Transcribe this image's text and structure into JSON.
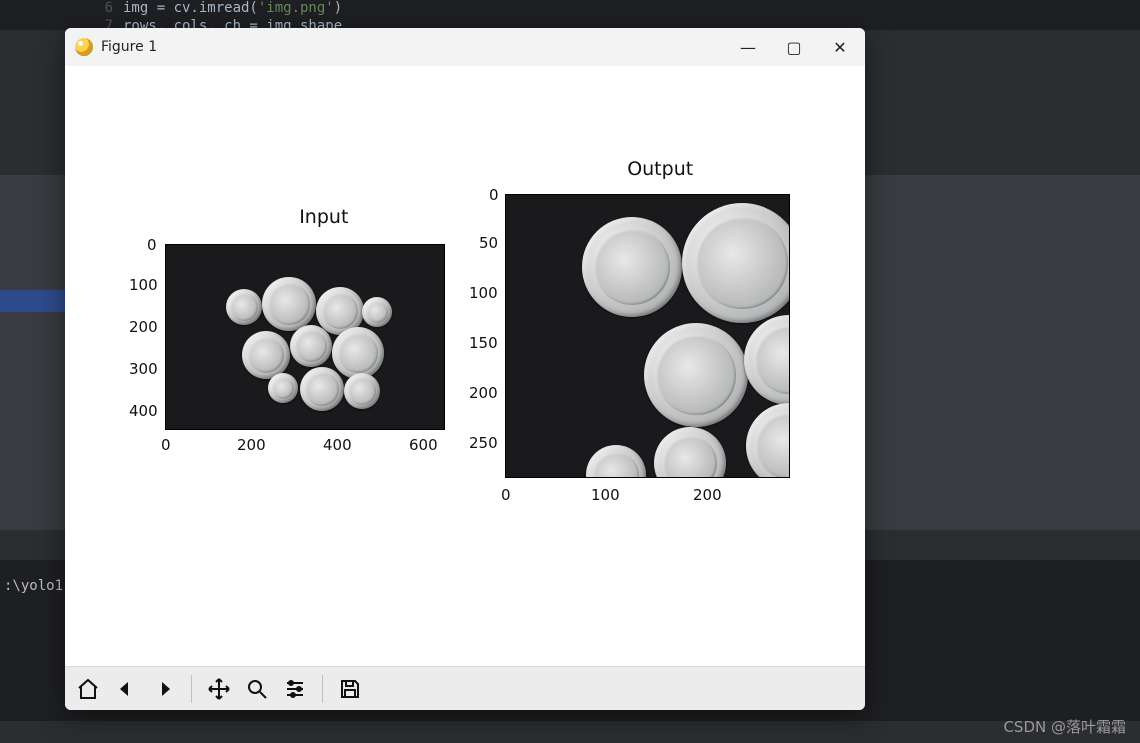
{
  "background": {
    "code_line1": {
      "num": "6",
      "text_pre": "img = cv.imread(",
      "string": "'img.png'",
      "text_post": ")"
    },
    "code_line2": {
      "num": "7",
      "text": "rows, cols, ch = img.shape"
    },
    "terminal_prompt": ":\\yolo1",
    "watermark": "CSDN @落叶霜霜"
  },
  "window": {
    "title": "Figure 1",
    "controls": {
      "min": "—",
      "max": "▢",
      "close": "✕"
    }
  },
  "toolbar": {
    "home": "home-icon",
    "back": "back-icon",
    "forward": "forward-icon",
    "pan": "pan-icon",
    "zoom": "zoom-icon",
    "config": "config-icon",
    "save": "save-icon"
  },
  "chart_data": [
    {
      "type": "image",
      "title": "Input",
      "xlim": [
        0,
        640
      ],
      "ylim": [
        440,
        0
      ],
      "xticks": [
        0,
        200,
        400,
        600
      ],
      "yticks": [
        0,
        100,
        200,
        300,
        400
      ],
      "description": "Photo of ~10 US coins on dark background"
    },
    {
      "type": "image",
      "title": "Output",
      "xlim": [
        0,
        280
      ],
      "ylim": [
        280,
        0
      ],
      "xticks": [
        0,
        100,
        200
      ],
      "yticks": [
        0,
        50,
        100,
        150,
        200,
        250
      ],
      "description": "Zoomed / scaled crop of the same coins image"
    }
  ]
}
